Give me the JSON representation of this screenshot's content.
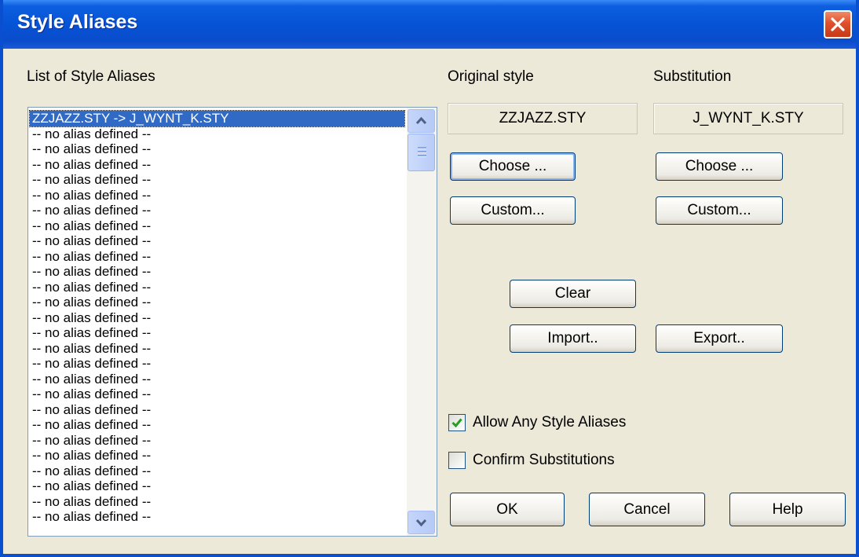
{
  "window": {
    "title": "Style Aliases"
  },
  "list": {
    "label": "List of Style Aliases",
    "items": [
      "ZZJAZZ.STY -> J_WYNT_K.STY",
      "-- no alias defined  --",
      "-- no alias defined  --",
      "-- no alias defined  --",
      "-- no alias defined  --",
      "-- no alias defined  --",
      "-- no alias defined  --",
      "-- no alias defined  --",
      "-- no alias defined  --",
      "-- no alias defined  --",
      "-- no alias defined  --",
      "-- no alias defined  --",
      "-- no alias defined  --",
      "-- no alias defined  --",
      "-- no alias defined  --",
      "-- no alias defined  --",
      "-- no alias defined  --",
      "-- no alias defined  --",
      "-- no alias defined  --",
      "-- no alias defined  --",
      "-- no alias defined  --",
      "-- no alias defined  --",
      "-- no alias defined  --",
      "-- no alias defined  --",
      "-- no alias defined  --",
      "-- no alias defined  --",
      "-- no alias defined  --"
    ],
    "selected_index": 0
  },
  "original": {
    "label": "Original style",
    "value": "ZZJAZZ.STY",
    "choose_label": "Choose ...",
    "custom_label": "Custom..."
  },
  "substitution": {
    "label": "Substitution",
    "value": "J_WYNT_K.STY",
    "choose_label": "Choose ...",
    "custom_label": "Custom..."
  },
  "actions": {
    "clear_label": "Clear",
    "import_label": "Import..",
    "export_label": "Export.."
  },
  "options": {
    "allow_label": "Allow Any Style Aliases",
    "allow_checked": true,
    "confirm_label": "Confirm Substitutions",
    "confirm_checked": false
  },
  "footer": {
    "ok_label": "OK",
    "cancel_label": "Cancel",
    "help_label": "Help"
  },
  "colors": {
    "title_bar": "#0653d6",
    "selection": "#316ac5",
    "dialog_face": "#ece9d8",
    "close_button": "#e1502b"
  }
}
